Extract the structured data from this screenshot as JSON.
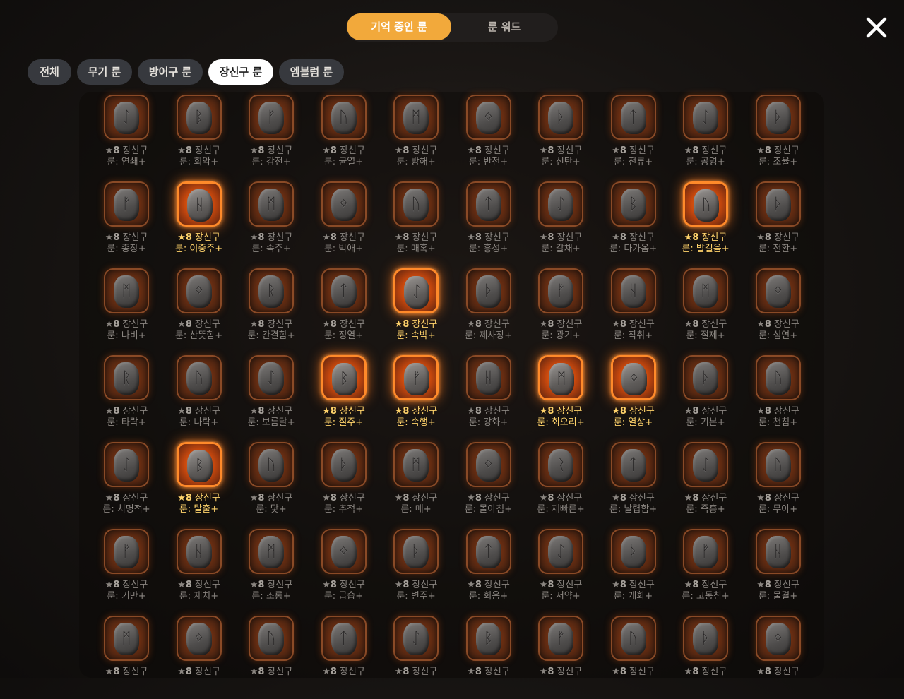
{
  "top_tabs": [
    {
      "label": "기억 중인 룬",
      "active": true
    },
    {
      "label": "룬 워드",
      "active": false
    }
  ],
  "filters": [
    {
      "label": "전체",
      "active": false
    },
    {
      "label": "무기 룬",
      "active": false
    },
    {
      "label": "방어구 룬",
      "active": false
    },
    {
      "label": "장신구 룬",
      "active": true
    },
    {
      "label": "엠블럼 룬",
      "active": false
    }
  ],
  "grade_prefix": "★",
  "grade_value": "8",
  "type_label": "장신구",
  "colors": {
    "accent": "#f2a93b",
    "highlight_text": "#ffd36b",
    "rune_glow": "#ff8a2a"
  },
  "runes": [
    [
      {
        "name": "룬: 연쇄+",
        "glyph": "ᛇ",
        "highlight": false
      },
      {
        "name": "룬: 회악+",
        "glyph": "ᛒ",
        "highlight": false
      },
      {
        "name": "룬: 감전+",
        "glyph": "ᚠ",
        "highlight": false
      },
      {
        "name": "룬: 균열+",
        "glyph": "ᚢ",
        "highlight": false
      },
      {
        "name": "룬: 방해+",
        "glyph": "ᛗ",
        "highlight": false
      },
      {
        "name": "룬: 반전+",
        "glyph": "ᛜ",
        "highlight": false
      },
      {
        "name": "룬: 신탄+",
        "glyph": "ᚦ",
        "highlight": false
      },
      {
        "name": "룬: 전류+",
        "glyph": "ᛏ",
        "highlight": false
      },
      {
        "name": "룬: 공명+",
        "glyph": "ᛇ",
        "highlight": false
      },
      {
        "name": "룬: 조율+",
        "glyph": "ᚦ",
        "highlight": false
      }
    ],
    [
      {
        "name": "룬: 종장+",
        "glyph": "ᚠ",
        "highlight": false
      },
      {
        "name": "룬: 이중주+",
        "glyph": "ᚺ",
        "highlight": true
      },
      {
        "name": "룬: 속주+",
        "glyph": "ᛗ",
        "highlight": false
      },
      {
        "name": "룬: 박애+",
        "glyph": "ᛜ",
        "highlight": false
      },
      {
        "name": "룬: 매혹+",
        "glyph": "ᚢ",
        "highlight": false
      },
      {
        "name": "룬: 흥성+",
        "glyph": "ᛏ",
        "highlight": false
      },
      {
        "name": "룬: 갈채+",
        "glyph": "ᛇ",
        "highlight": false
      },
      {
        "name": "룬: 다가옴+",
        "glyph": "ᛒ",
        "highlight": false
      },
      {
        "name": "룬: 발걸음+",
        "glyph": "ᚢ",
        "highlight": true
      },
      {
        "name": "룬: 전환+",
        "glyph": "ᚦ",
        "highlight": false
      }
    ],
    [
      {
        "name": "룬: 나비+",
        "glyph": "ᛗ",
        "highlight": false
      },
      {
        "name": "룬: 산뜻함+",
        "glyph": "ᛜ",
        "highlight": false
      },
      {
        "name": "룬: 간결함+",
        "glyph": "ᚱ",
        "highlight": false
      },
      {
        "name": "룬: 정열+",
        "glyph": "ᛏ",
        "highlight": false
      },
      {
        "name": "룬: 속박+",
        "glyph": "ᛇ",
        "highlight": true
      },
      {
        "name": "룬: 제사장+",
        "glyph": "ᚦ",
        "highlight": false
      },
      {
        "name": "룬: 광기+",
        "glyph": "ᚠ",
        "highlight": false
      },
      {
        "name": "룬: 작취+",
        "glyph": "ᚺ",
        "highlight": false
      },
      {
        "name": "룬: 절제+",
        "glyph": "ᛗ",
        "highlight": false
      },
      {
        "name": "룬: 심연+",
        "glyph": "ᛜ",
        "highlight": false
      }
    ],
    [
      {
        "name": "룬: 타락+",
        "glyph": "ᚱ",
        "highlight": false
      },
      {
        "name": "룬: 나락+",
        "glyph": "ᚢ",
        "highlight": false
      },
      {
        "name": "룬: 보름달+",
        "glyph": "ᛇ",
        "highlight": false
      },
      {
        "name": "룬: 질주+",
        "glyph": "ᛒ",
        "highlight": true
      },
      {
        "name": "룬: 속행+",
        "glyph": "ᚠ",
        "highlight": true
      },
      {
        "name": "룬: 강화+",
        "glyph": "ᚺ",
        "highlight": false
      },
      {
        "name": "룬: 회오리+",
        "glyph": "ᛗ",
        "highlight": true
      },
      {
        "name": "룬: 열상+",
        "glyph": "ᛜ",
        "highlight": true
      },
      {
        "name": "룬: 기본+",
        "glyph": "ᚦ",
        "highlight": false
      },
      {
        "name": "룬: 천침+",
        "glyph": "ᚢ",
        "highlight": false
      }
    ],
    [
      {
        "name": "룬: 치명적+",
        "glyph": "ᛇ",
        "highlight": false
      },
      {
        "name": "룬: 탈출+",
        "glyph": "ᛒ",
        "highlight": true
      },
      {
        "name": "룬: 닻+",
        "glyph": "ᚢ",
        "highlight": false
      },
      {
        "name": "룬: 추적+",
        "glyph": "ᚦ",
        "highlight": false
      },
      {
        "name": "룬: 매+",
        "glyph": "ᛗ",
        "highlight": false
      },
      {
        "name": "룬: 몰아침+",
        "glyph": "ᛜ",
        "highlight": false
      },
      {
        "name": "룬: 재빠른+",
        "glyph": "ᚱ",
        "highlight": false
      },
      {
        "name": "룬: 날렵함+",
        "glyph": "ᛏ",
        "highlight": false
      },
      {
        "name": "룬: 즉흥+",
        "glyph": "ᛇ",
        "highlight": false
      },
      {
        "name": "룬: 무아+",
        "glyph": "ᚢ",
        "highlight": false
      }
    ],
    [
      {
        "name": "룬: 기만+",
        "glyph": "ᚠ",
        "highlight": false
      },
      {
        "name": "룬: 재치+",
        "glyph": "ᚺ",
        "highlight": false
      },
      {
        "name": "룬: 조롱+",
        "glyph": "ᛗ",
        "highlight": false
      },
      {
        "name": "룬: 급습+",
        "glyph": "ᛜ",
        "highlight": false
      },
      {
        "name": "룬: 변주+",
        "glyph": "ᚦ",
        "highlight": false
      },
      {
        "name": "룬: 회음+",
        "glyph": "ᛏ",
        "highlight": false
      },
      {
        "name": "룬: 서약+",
        "glyph": "ᛇ",
        "highlight": false
      },
      {
        "name": "룬: 개화+",
        "glyph": "ᚦ",
        "highlight": false
      },
      {
        "name": "룬: 고동침+",
        "glyph": "ᚠ",
        "highlight": false
      },
      {
        "name": "룬: 물결+",
        "glyph": "ᚺ",
        "highlight": false
      }
    ],
    [
      {
        "name": "",
        "glyph": "ᛗ",
        "highlight": false
      },
      {
        "name": "",
        "glyph": "ᛜ",
        "highlight": false
      },
      {
        "name": "",
        "glyph": "ᚢ",
        "highlight": false
      },
      {
        "name": "",
        "glyph": "ᛏ",
        "highlight": false
      },
      {
        "name": "",
        "glyph": "ᛇ",
        "highlight": false
      },
      {
        "name": "",
        "glyph": "ᛒ",
        "highlight": false
      },
      {
        "name": "",
        "glyph": "ᚠ",
        "highlight": false
      },
      {
        "name": "",
        "glyph": "ᚢ",
        "highlight": false
      },
      {
        "name": "",
        "glyph": "ᚦ",
        "highlight": false
      },
      {
        "name": "",
        "glyph": "ᛜ",
        "highlight": false
      }
    ]
  ]
}
